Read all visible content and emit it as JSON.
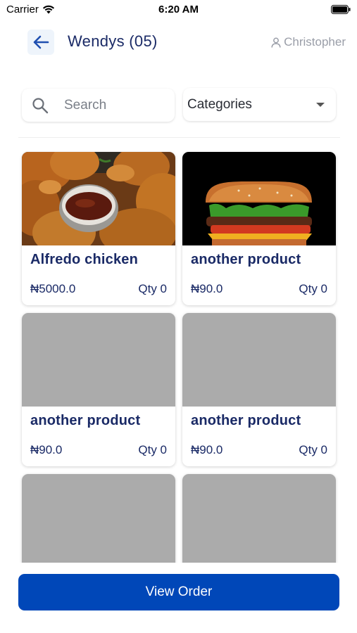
{
  "status_bar": {
    "carrier": "Carrier",
    "time": "6:20 AM"
  },
  "header": {
    "title": "Wendys (05)",
    "user_name": "Christopher"
  },
  "search": {
    "placeholder": "Search",
    "value": ""
  },
  "categories": {
    "label": "Categories"
  },
  "products": [
    {
      "name": "Alfredo chicken",
      "price": "₦5000.0",
      "qty": "Qty 0",
      "image": "fried-chicken-photo"
    },
    {
      "name": "another product",
      "price": "₦90.0",
      "qty": "Qty 0",
      "image": "burger-photo"
    },
    {
      "name": "another product",
      "price": "₦90.0",
      "qty": "Qty 0",
      "image": "placeholder"
    },
    {
      "name": "another product",
      "price": "₦90.0",
      "qty": "Qty 0",
      "image": "placeholder"
    },
    {
      "name": "",
      "price": "",
      "qty": "",
      "image": "placeholder"
    },
    {
      "name": "",
      "price": "",
      "qty": "",
      "image": "placeholder"
    }
  ],
  "footer": {
    "view_order_label": "View Order"
  },
  "colors": {
    "primary": "#0047b8",
    "title": "#1a2a66",
    "placeholder_image": "#ababab"
  }
}
